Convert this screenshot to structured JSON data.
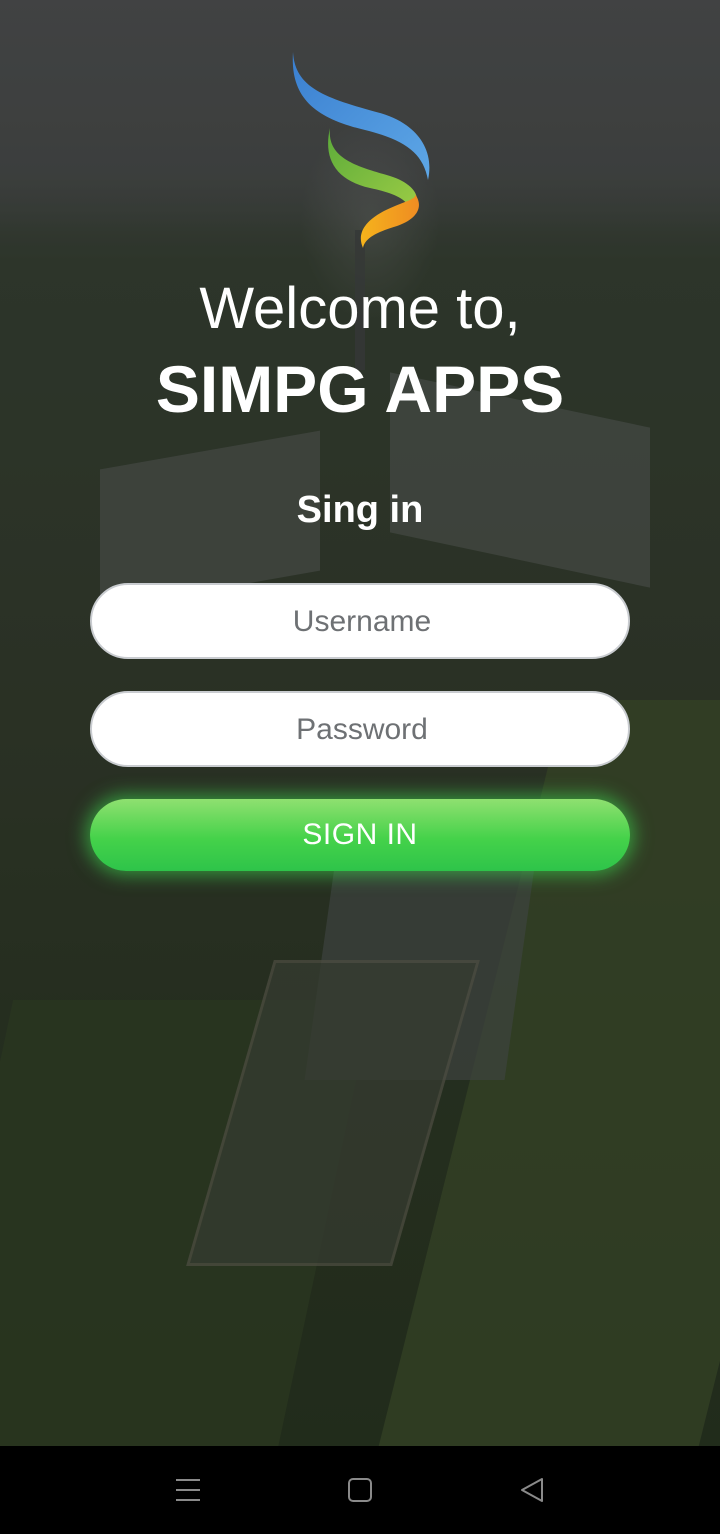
{
  "welcome": {
    "line1": "Welcome to,",
    "app_name": "SIMPG APPS"
  },
  "form": {
    "heading": "Sing in",
    "username_placeholder": "Username",
    "password_placeholder": "Password",
    "submit_label": "SIGN IN"
  },
  "system_nav": {
    "menu_icon": "menu-lines-icon",
    "home_icon": "square-home-icon",
    "back_icon": "triangle-back-icon"
  },
  "colors": {
    "button_green": "#45d24a",
    "logo_blue": "#3f86d6",
    "logo_green": "#7ac13f",
    "logo_orange": "#f2a81d",
    "nav_bar": "#000000",
    "text": "#ffffff"
  }
}
